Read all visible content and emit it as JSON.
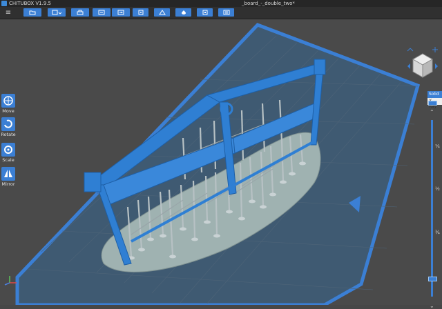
{
  "window": {
    "app_name": "CHITUBOX V1.9.5",
    "document_title": "_board_-_double_two*"
  },
  "toolbar": {
    "menu_icon": "hamburger-icon",
    "buttons": [
      {
        "name": "open-file",
        "icon": "folder-icon"
      },
      {
        "name": "save-file",
        "icon": "save-icon"
      },
      {
        "name": "print-job",
        "icon": "printer-icon"
      },
      {
        "name": "import",
        "icon": "import-icon"
      },
      {
        "name": "export",
        "icon": "export-icon"
      },
      {
        "name": "settings",
        "icon": "settings-icon"
      },
      {
        "name": "layout",
        "icon": "layout-icon"
      },
      {
        "name": "hollow",
        "icon": "hollow-icon"
      },
      {
        "name": "boolean",
        "icon": "boolean-icon"
      },
      {
        "name": "slice",
        "icon": "slice-icon"
      }
    ]
  },
  "left_tools": [
    {
      "label": "Move",
      "icon": "move-icon"
    },
    {
      "label": "Rotate",
      "icon": "rotate-icon"
    },
    {
      "label": "Scale",
      "icon": "scale-icon"
    },
    {
      "label": "Mirror",
      "icon": "mirror-icon"
    }
  ],
  "view_mode": {
    "solid": "Solid",
    "xray": "X-Ray"
  },
  "layer_slider": {
    "ticks": [
      "¼",
      "½",
      "¾"
    ]
  },
  "colors": {
    "accent": "#3b7fd4",
    "background": "#474747",
    "model": "#2f7fd3",
    "supports": "#a8b2b6",
    "raft": "#9fb2b1"
  }
}
